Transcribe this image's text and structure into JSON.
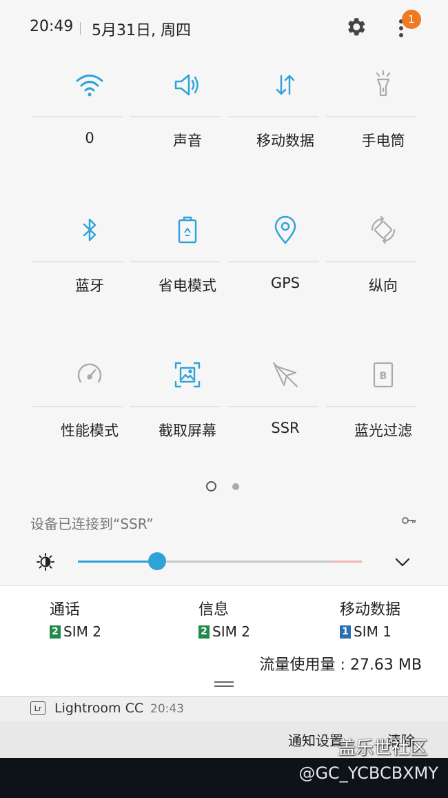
{
  "status": {
    "time": "20:49",
    "date": "5月31日, 周四",
    "badge_count": "1"
  },
  "tiles": [
    {
      "label": "0",
      "icon": "wifi-icon",
      "active": true
    },
    {
      "label": "声音",
      "icon": "sound-icon",
      "active": true
    },
    {
      "label": "移动数据",
      "icon": "mobile-data-icon",
      "active": true
    },
    {
      "label": "手电筒",
      "icon": "flashlight-icon",
      "active": false
    },
    {
      "label": "蓝牙",
      "icon": "bluetooth-icon",
      "active": true
    },
    {
      "label": "省电模式",
      "icon": "power-saving-icon",
      "active": true
    },
    {
      "label": "GPS",
      "icon": "gps-icon",
      "active": true
    },
    {
      "label": "纵向",
      "icon": "rotation-icon",
      "active": false
    },
    {
      "label": "性能模式",
      "icon": "performance-icon",
      "active": false
    },
    {
      "label": "截取屏幕",
      "icon": "screenshot-icon",
      "active": true
    },
    {
      "label": "SSR",
      "icon": "ssr-icon",
      "active": false
    },
    {
      "label": "蓝光过滤",
      "icon": "blue-light-filter-icon",
      "active": false
    }
  ],
  "pager": {
    "pages": 2,
    "current": 1
  },
  "connection": {
    "text": "设备已连接到“SSR”"
  },
  "brightness": {
    "level": 0.28
  },
  "sim": {
    "call": {
      "title": "通话",
      "slot": "2",
      "name": "SIM 2"
    },
    "message": {
      "title": "信息",
      "slot": "2",
      "name": "SIM 2"
    },
    "data": {
      "title": "移动数据",
      "slot": "1",
      "name": "SIM 1"
    },
    "usage": "流量使用量 : 27.63 MB"
  },
  "notification": {
    "app_icon_text": "Lr",
    "app": "Lightroom CC",
    "time": "20:43"
  },
  "actions": {
    "settings": "通知设置",
    "clear": "清除"
  },
  "watermark": {
    "site": "盖乐世社区",
    "user": "@GC_YCBCBXMY"
  },
  "colors": {
    "accent": "#2fa3d8",
    "inactive": "#aaaaaa",
    "badge": "#f07a22",
    "sim1": "#2a6fb3",
    "sim2": "#1f8a4c"
  }
}
